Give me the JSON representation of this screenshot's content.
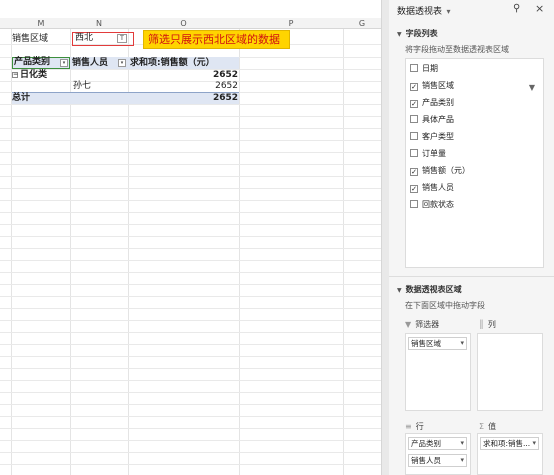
{
  "sheet": {
    "columns": [
      "M",
      "N",
      "O",
      "P",
      "G"
    ],
    "filter": {
      "label": "销售区域",
      "value": "西北",
      "button_icon": "filter-dropdown-icon"
    },
    "annotation": "筛选只展示西北区域的数据",
    "pivot": {
      "headers": [
        "产品类别",
        "销售人员",
        "求和项:销售额（元）"
      ],
      "group": {
        "name": "日化类",
        "subtotal": "2652"
      },
      "rows": [
        {
          "person": "孙七",
          "value": "2652"
        }
      ],
      "total": {
        "label": "总计",
        "value": "2652"
      }
    }
  },
  "pane": {
    "title": "数据透视表",
    "field_section": {
      "title": "字段列表",
      "hint": "将字段拖动至数据透视表区域"
    },
    "fields": [
      {
        "label": "日期",
        "checked": false
      },
      {
        "label": "销售区域",
        "checked": true,
        "filtered": true
      },
      {
        "label": "产品类别",
        "checked": true
      },
      {
        "label": "具体产品",
        "checked": false
      },
      {
        "label": "客户类型",
        "checked": false
      },
      {
        "label": "订单量",
        "checked": false
      },
      {
        "label": "销售额（元）",
        "checked": true
      },
      {
        "label": "销售人员",
        "checked": true
      },
      {
        "label": "回款状态",
        "checked": false
      }
    ],
    "areas_section": {
      "title": "数据透视表区域",
      "hint": "在下面区域中拖动字段"
    },
    "areas": {
      "filter": {
        "label": "筛选器",
        "items": [
          "销售区域"
        ]
      },
      "columns": {
        "label": "列",
        "items": []
      },
      "rows": {
        "label": "行",
        "items": [
          "产品类别",
          "销售人员"
        ]
      },
      "values": {
        "label": "值",
        "items": [
          "求和项:销售..."
        ]
      }
    }
  }
}
